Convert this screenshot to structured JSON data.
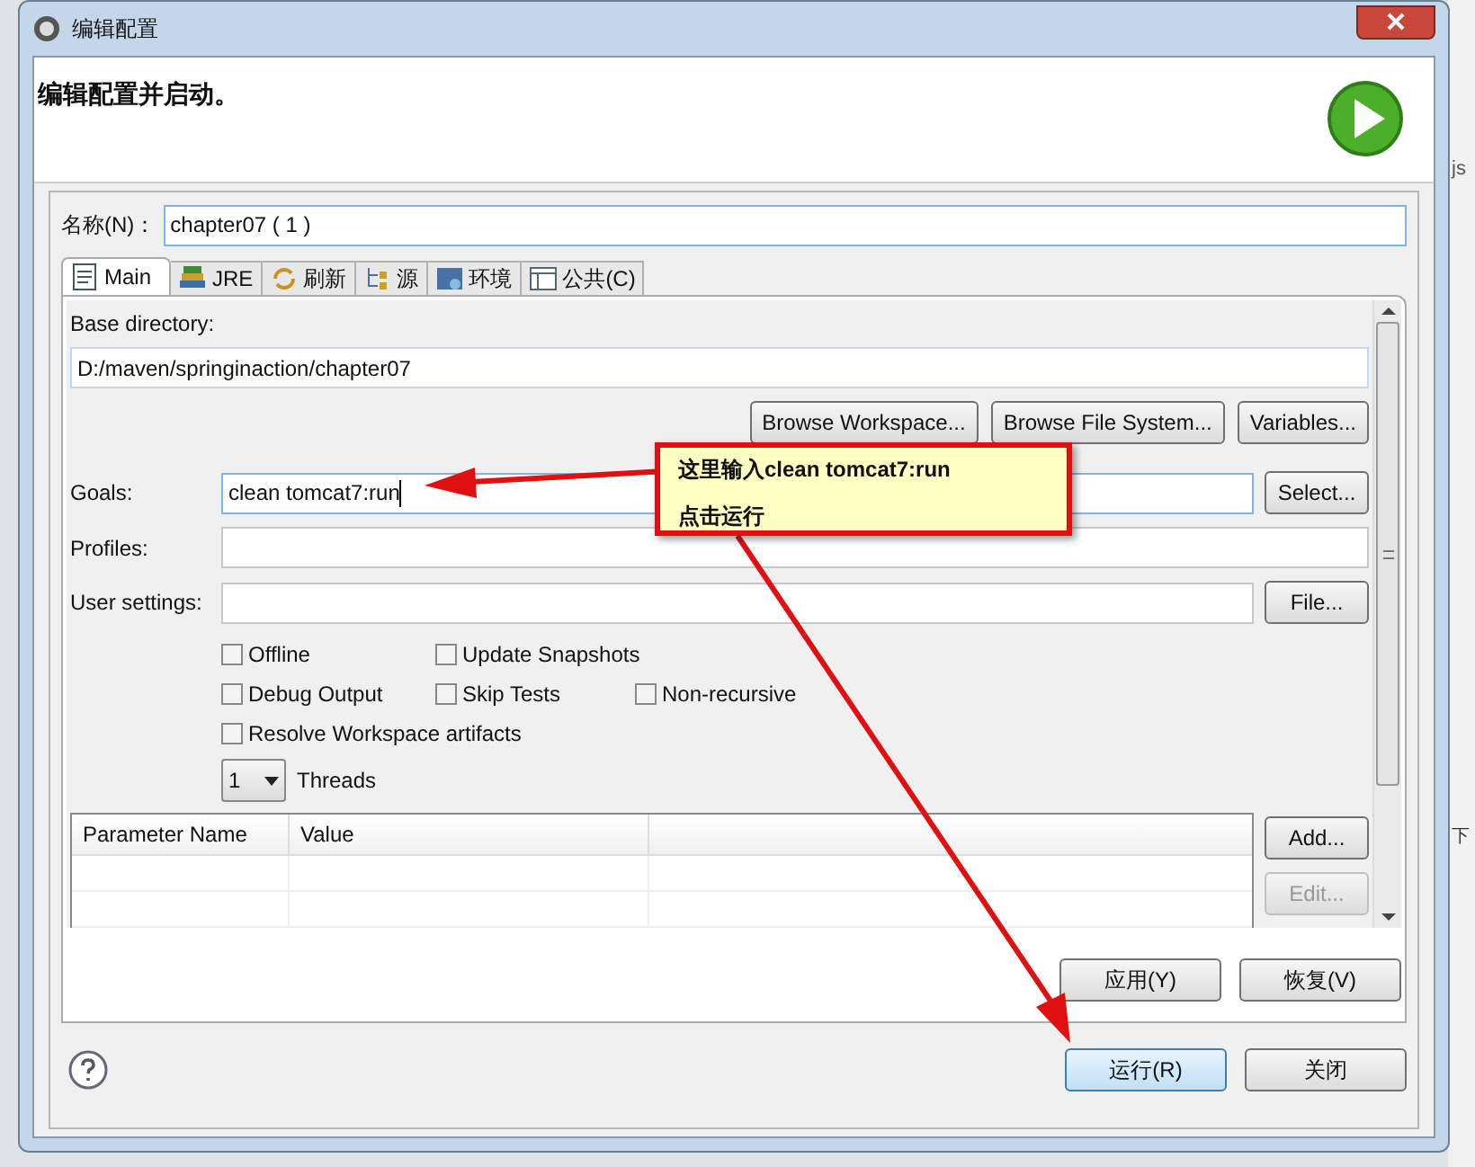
{
  "window": {
    "title": "编辑配置"
  },
  "header": {
    "title": "编辑配置并启动。"
  },
  "name_field": {
    "label": "名称(N)：",
    "value": "chapter07 ( 1 )"
  },
  "tabs": [
    {
      "label": "Main",
      "selected": true
    },
    {
      "label": "JRE",
      "selected": false
    },
    {
      "label": "刷新",
      "selected": false
    },
    {
      "label": "源",
      "selected": false
    },
    {
      "label": "环境",
      "selected": false
    },
    {
      "label": "公共(C)",
      "selected": false
    }
  ],
  "base_directory": {
    "label": "Base directory:",
    "value": "D:/maven/springinaction/chapter07"
  },
  "browse_buttons": [
    "Browse Workspace...",
    "Browse File System...",
    "Variables..."
  ],
  "fields": [
    {
      "label": "Goals:",
      "value": "clean tomcat7:run",
      "focused": true,
      "button": "Select..."
    },
    {
      "label": "Profiles:",
      "focused": false
    },
    {
      "label": "User settings:",
      "focused": false,
      "button": "File..."
    }
  ],
  "checkbox_rows": [
    [
      {
        "label": "Offline",
        "checked": false
      },
      {
        "label": "Update Snapshots",
        "checked": false
      }
    ],
    [
      {
        "label": "Debug Output",
        "checked": false
      },
      {
        "label": "Skip Tests",
        "checked": false
      },
      {
        "label": "Non-recursive",
        "checked": false
      }
    ],
    [
      {
        "label": "Resolve Workspace artifacts",
        "checked": false
      }
    ]
  ],
  "threads": {
    "value": "1",
    "label": "Threads"
  },
  "parameter_table": {
    "columns": [
      "Parameter Name",
      "Value"
    ]
  },
  "table_buttons": [
    {
      "label": "Add...",
      "disabled": false
    },
    {
      "label": "Edit...",
      "disabled": true
    }
  ],
  "panel_buttons": [
    "应用(Y)",
    "恢复(V)"
  ],
  "footer_buttons": [
    {
      "label": "运行(R)",
      "default": true
    },
    {
      "label": "关闭",
      "default": false
    }
  ],
  "callout": {
    "lines": [
      "这里输入clean tomcat7:run",
      "点击运行"
    ]
  },
  "background": {
    "texts": [
      "js",
      "下"
    ]
  }
}
